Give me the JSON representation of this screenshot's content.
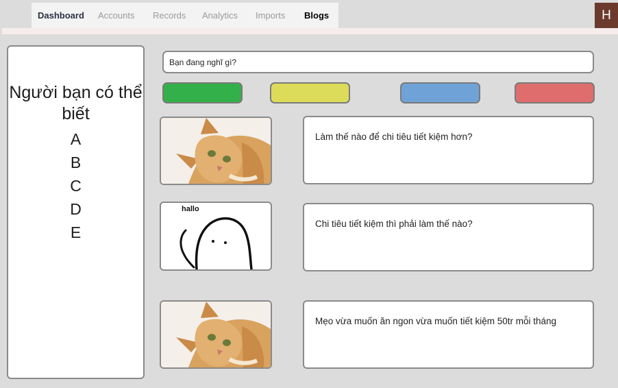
{
  "nav": {
    "items": [
      "Dashboard",
      "Accounts",
      "Records",
      "Analytics",
      "Imports",
      "Blogs"
    ]
  },
  "user": {
    "initial": "H"
  },
  "sidebar": {
    "title": "Người bạn có thể biết",
    "people": [
      "A",
      "B",
      "C",
      "D",
      "E"
    ]
  },
  "composer": {
    "value": "Bạn đang nghĩ gì?",
    "color_buttons": [
      "#34b04a",
      "#dcdc5a",
      "#6fa3d8",
      "#e06d6d"
    ]
  },
  "posts": [
    {
      "image": "cat-photo",
      "text": "Làm thế nào để chi tiêu tiết kiệm hơn?"
    },
    {
      "image": "ghost-doodle",
      "image_label": "hallo",
      "text": "Chi tiêu tiết kiệm thì phải làm thế nào?"
    },
    {
      "image": "cat-photo",
      "text": "Mẹo vừa muốn ăn ngon vừa muốn tiết kiệm 50tr mỗi tháng"
    }
  ],
  "colors": {
    "avatar_bg": "#6b3a2d",
    "page_bg": "#dcdcdc"
  }
}
